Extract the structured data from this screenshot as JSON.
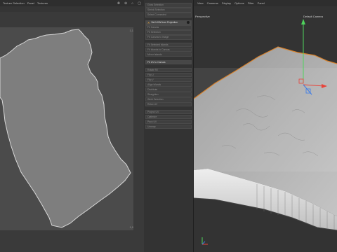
{
  "uv_editor": {
    "menu": [
      "Texture Selection",
      "Panel",
      "Textures"
    ],
    "icons": [
      "move-icon",
      "zoom-icon",
      "home-icon",
      "frame-icon"
    ],
    "corner_labels": {
      "top_right": "1,1",
      "bottom_right": "1,0"
    }
  },
  "commands": {
    "group1": [
      "Grow Selection",
      "Shrink Selection",
      "Select Connected"
    ],
    "highlighted": "Set UVW from Projection",
    "group2": [
      "Fit Canvas",
      "Fit Selection",
      "Fit Canvas to Image",
      "Fit Selected Islands",
      "Fit Islands to Canvas",
      "Mirror Islands"
    ],
    "selected": "Fit UV to Canvas",
    "group3": [
      "Rotate 90",
      "Flip U",
      "Flip V",
      "Align Islands",
      "Distribute",
      "Straighten",
      "Weld Selection",
      "Relax UV"
    ],
    "group4": [
      "Project UV",
      "Optimize",
      "Pack UV",
      "Unwrap"
    ],
    "dot_icon": "record-icon"
  },
  "viewport": {
    "menu": [
      "View",
      "Cameras",
      "Display",
      "Options",
      "Filter",
      "Panel"
    ],
    "view_name": "Perspective",
    "camera": "Default Camera",
    "axis_colors": {
      "x": "#e8433a",
      "y": "#4fd35c",
      "z": "#3a7be8"
    }
  }
}
